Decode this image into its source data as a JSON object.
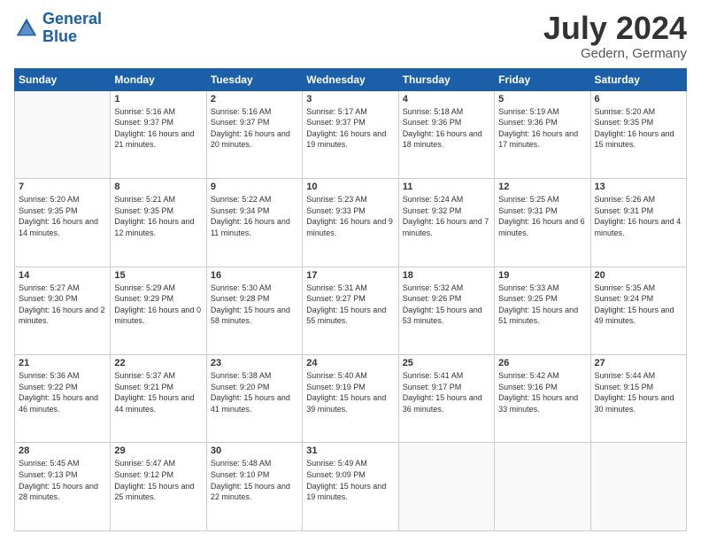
{
  "logo": {
    "line1": "General",
    "line2": "Blue"
  },
  "title": "July 2024",
  "location": "Gedern, Germany",
  "days_header": [
    "Sunday",
    "Monday",
    "Tuesday",
    "Wednesday",
    "Thursday",
    "Friday",
    "Saturday"
  ],
  "weeks": [
    [
      {
        "day": "",
        "sunrise": "",
        "sunset": "",
        "daylight": ""
      },
      {
        "day": "1",
        "sunrise": "Sunrise: 5:16 AM",
        "sunset": "Sunset: 9:37 PM",
        "daylight": "Daylight: 16 hours and 21 minutes."
      },
      {
        "day": "2",
        "sunrise": "Sunrise: 5:16 AM",
        "sunset": "Sunset: 9:37 PM",
        "daylight": "Daylight: 16 hours and 20 minutes."
      },
      {
        "day": "3",
        "sunrise": "Sunrise: 5:17 AM",
        "sunset": "Sunset: 9:37 PM",
        "daylight": "Daylight: 16 hours and 19 minutes."
      },
      {
        "day": "4",
        "sunrise": "Sunrise: 5:18 AM",
        "sunset": "Sunset: 9:36 PM",
        "daylight": "Daylight: 16 hours and 18 minutes."
      },
      {
        "day": "5",
        "sunrise": "Sunrise: 5:19 AM",
        "sunset": "Sunset: 9:36 PM",
        "daylight": "Daylight: 16 hours and 17 minutes."
      },
      {
        "day": "6",
        "sunrise": "Sunrise: 5:20 AM",
        "sunset": "Sunset: 9:35 PM",
        "daylight": "Daylight: 16 hours and 15 minutes."
      }
    ],
    [
      {
        "day": "7",
        "sunrise": "Sunrise: 5:20 AM",
        "sunset": "Sunset: 9:35 PM",
        "daylight": "Daylight: 16 hours and 14 minutes."
      },
      {
        "day": "8",
        "sunrise": "Sunrise: 5:21 AM",
        "sunset": "Sunset: 9:35 PM",
        "daylight": "Daylight: 16 hours and 12 minutes."
      },
      {
        "day": "9",
        "sunrise": "Sunrise: 5:22 AM",
        "sunset": "Sunset: 9:34 PM",
        "daylight": "Daylight: 16 hours and 11 minutes."
      },
      {
        "day": "10",
        "sunrise": "Sunrise: 5:23 AM",
        "sunset": "Sunset: 9:33 PM",
        "daylight": "Daylight: 16 hours and 9 minutes."
      },
      {
        "day": "11",
        "sunrise": "Sunrise: 5:24 AM",
        "sunset": "Sunset: 9:32 PM",
        "daylight": "Daylight: 16 hours and 7 minutes."
      },
      {
        "day": "12",
        "sunrise": "Sunrise: 5:25 AM",
        "sunset": "Sunset: 9:31 PM",
        "daylight": "Daylight: 16 hours and 6 minutes."
      },
      {
        "day": "13",
        "sunrise": "Sunrise: 5:26 AM",
        "sunset": "Sunset: 9:31 PM",
        "daylight": "Daylight: 16 hours and 4 minutes."
      }
    ],
    [
      {
        "day": "14",
        "sunrise": "Sunrise: 5:27 AM",
        "sunset": "Sunset: 9:30 PM",
        "daylight": "Daylight: 16 hours and 2 minutes."
      },
      {
        "day": "15",
        "sunrise": "Sunrise: 5:29 AM",
        "sunset": "Sunset: 9:29 PM",
        "daylight": "Daylight: 16 hours and 0 minutes."
      },
      {
        "day": "16",
        "sunrise": "Sunrise: 5:30 AM",
        "sunset": "Sunset: 9:28 PM",
        "daylight": "Daylight: 15 hours and 58 minutes."
      },
      {
        "day": "17",
        "sunrise": "Sunrise: 5:31 AM",
        "sunset": "Sunset: 9:27 PM",
        "daylight": "Daylight: 15 hours and 55 minutes."
      },
      {
        "day": "18",
        "sunrise": "Sunrise: 5:32 AM",
        "sunset": "Sunset: 9:26 PM",
        "daylight": "Daylight: 15 hours and 53 minutes."
      },
      {
        "day": "19",
        "sunrise": "Sunrise: 5:33 AM",
        "sunset": "Sunset: 9:25 PM",
        "daylight": "Daylight: 15 hours and 51 minutes."
      },
      {
        "day": "20",
        "sunrise": "Sunrise: 5:35 AM",
        "sunset": "Sunset: 9:24 PM",
        "daylight": "Daylight: 15 hours and 49 minutes."
      }
    ],
    [
      {
        "day": "21",
        "sunrise": "Sunrise: 5:36 AM",
        "sunset": "Sunset: 9:22 PM",
        "daylight": "Daylight: 15 hours and 46 minutes."
      },
      {
        "day": "22",
        "sunrise": "Sunrise: 5:37 AM",
        "sunset": "Sunset: 9:21 PM",
        "daylight": "Daylight: 15 hours and 44 minutes."
      },
      {
        "day": "23",
        "sunrise": "Sunrise: 5:38 AM",
        "sunset": "Sunset: 9:20 PM",
        "daylight": "Daylight: 15 hours and 41 minutes."
      },
      {
        "day": "24",
        "sunrise": "Sunrise: 5:40 AM",
        "sunset": "Sunset: 9:19 PM",
        "daylight": "Daylight: 15 hours and 39 minutes."
      },
      {
        "day": "25",
        "sunrise": "Sunrise: 5:41 AM",
        "sunset": "Sunset: 9:17 PM",
        "daylight": "Daylight: 15 hours and 36 minutes."
      },
      {
        "day": "26",
        "sunrise": "Sunrise: 5:42 AM",
        "sunset": "Sunset: 9:16 PM",
        "daylight": "Daylight: 15 hours and 33 minutes."
      },
      {
        "day": "27",
        "sunrise": "Sunrise: 5:44 AM",
        "sunset": "Sunset: 9:15 PM",
        "daylight": "Daylight: 15 hours and 30 minutes."
      }
    ],
    [
      {
        "day": "28",
        "sunrise": "Sunrise: 5:45 AM",
        "sunset": "Sunset: 9:13 PM",
        "daylight": "Daylight: 15 hours and 28 minutes."
      },
      {
        "day": "29",
        "sunrise": "Sunrise: 5:47 AM",
        "sunset": "Sunset: 9:12 PM",
        "daylight": "Daylight: 15 hours and 25 minutes."
      },
      {
        "day": "30",
        "sunrise": "Sunrise: 5:48 AM",
        "sunset": "Sunset: 9:10 PM",
        "daylight": "Daylight: 15 hours and 22 minutes."
      },
      {
        "day": "31",
        "sunrise": "Sunrise: 5:49 AM",
        "sunset": "Sunset: 9:09 PM",
        "daylight": "Daylight: 15 hours and 19 minutes."
      },
      {
        "day": "",
        "sunrise": "",
        "sunset": "",
        "daylight": ""
      },
      {
        "day": "",
        "sunrise": "",
        "sunset": "",
        "daylight": ""
      },
      {
        "day": "",
        "sunrise": "",
        "sunset": "",
        "daylight": ""
      }
    ]
  ]
}
